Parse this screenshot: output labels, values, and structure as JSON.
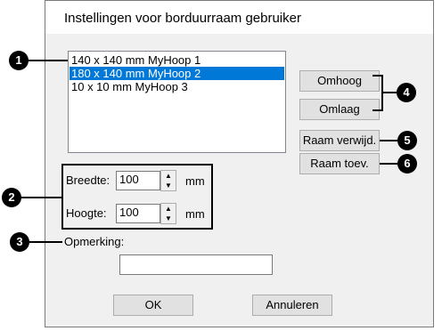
{
  "dialog": {
    "title": "Instellingen voor borduurraam gebruiker"
  },
  "hoop_list": {
    "items": [
      {
        "label": "140 x 140 mm MyHoop 1",
        "selected": false
      },
      {
        "label": "180 x 140 mm MyHoop 2",
        "selected": true
      },
      {
        "label": "10 x 10 mm MyHoop 3",
        "selected": false
      }
    ]
  },
  "buttons": {
    "up": "Omhoog",
    "down": "Omlaag",
    "delete": "Raam verwijd.",
    "add": "Raam toev.",
    "ok": "OK",
    "cancel": "Annuleren"
  },
  "size": {
    "width_label": "Breedte:",
    "width_value": "100",
    "height_label": "Hoogte:",
    "height_value": "100",
    "unit": "mm"
  },
  "comment": {
    "label": "Opmerking:",
    "value": ""
  },
  "callouts": [
    "1",
    "2",
    "3",
    "4",
    "5",
    "6"
  ],
  "icons": {
    "spin_up": "spin-up-icon",
    "spin_down": "spin-down-icon"
  },
  "colors": {
    "selection": "#0078d7",
    "dialog_bg": "#f0f0f0",
    "callout": "#000000"
  }
}
